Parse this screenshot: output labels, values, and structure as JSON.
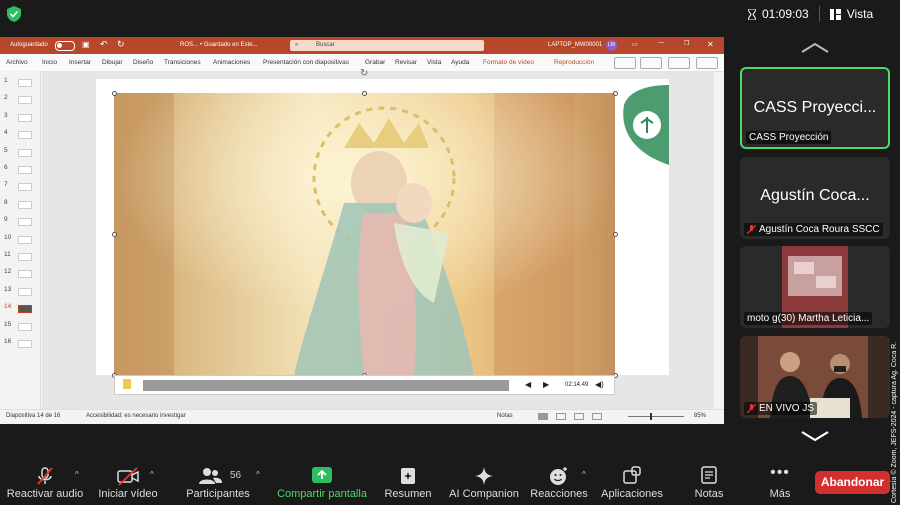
{
  "top": {
    "timer": "01:09:03",
    "view_label": "Vista"
  },
  "powerpoint": {
    "autosave": "Autoguardado",
    "file_name": "ROS...",
    "saved_status": "• Guardado en Este...",
    "search_placeholder": "Buscar",
    "device": "LAPTOP_MW00001",
    "user_initials": "LM",
    "menu": [
      "Archivo",
      "Inicio",
      "Insertar",
      "Dibujar",
      "Diseño",
      "Transiciones",
      "Animaciones",
      "Presentación con diapositivas",
      "Grabar",
      "Revisar",
      "Vista",
      "Ayuda",
      "Formato de vídeo",
      "Reproducción"
    ],
    "slide_numbers": [
      "1",
      "2",
      "3",
      "4",
      "5",
      "6",
      "7",
      "8",
      "9",
      "10",
      "11",
      "12",
      "13",
      "14",
      "15",
      "16"
    ],
    "active_slide": "14",
    "video_time": "02:14.49",
    "status": {
      "slide_of": "Diapositiva 14 de 16",
      "accessibility": "Accesibilidad: es necesario investigar",
      "notes": "Notas",
      "zoom": "85%"
    }
  },
  "participants": [
    {
      "big": "CASS Proyecci...",
      "name": "CASS Proyección",
      "muted": false,
      "active": true
    },
    {
      "big": "Agustín Coca...",
      "name": "Agustín Coca Roura SSCC",
      "muted": true,
      "active": false
    },
    {
      "big": "",
      "name": "moto g(30) Martha Leticia...",
      "muted": false,
      "active": false
    },
    {
      "big": "",
      "name": "EN VIVO JS",
      "muted": true,
      "active": false
    }
  ],
  "toolbar": {
    "mic": "Reactivar audio",
    "video": "Iniciar vídeo",
    "participants": "Participantes",
    "participants_count": "56",
    "share": "Compartir pantalla",
    "summary": "Resumen",
    "ai": "AI Companion",
    "reactions": "Reacciones",
    "apps": "Aplicaciones",
    "notes": "Notas",
    "more": "Más",
    "leave": "Abandonar"
  },
  "credit": "Cortesía © Zoom, JEFS-2024 - captura Ag. Coca R.",
  "colors": {
    "accent_green": "#4cd964",
    "ppt_red": "#b7472a",
    "leave_red": "#d32f2f"
  }
}
